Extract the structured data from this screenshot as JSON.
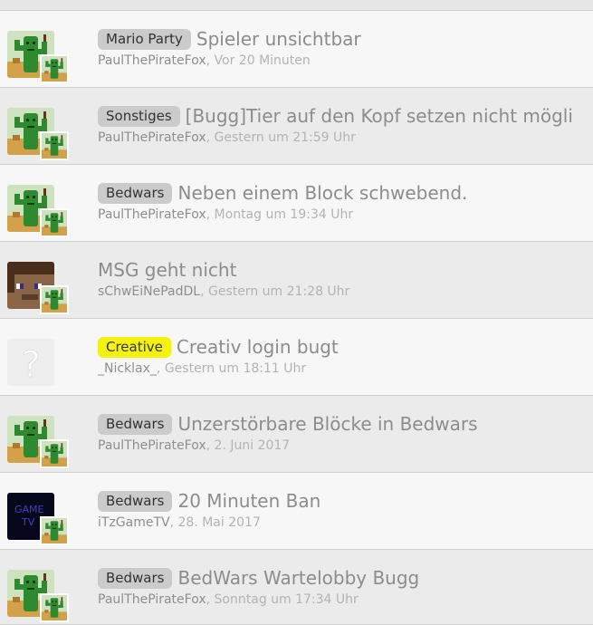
{
  "threads": [
    {
      "prefix": "Mario Party",
      "prefix_style": "gray",
      "title": "Spieler unsichtbar",
      "user": "PaulThePirateFox",
      "time": "Vor 20 Minuten",
      "avatar": "cactus-avatar-icon"
    },
    {
      "prefix": "Sonstiges",
      "prefix_style": "gray",
      "title": "[Bugg]Tier auf den Kopf setzen nicht mögli",
      "user": "PaulThePirateFox",
      "time": "Gestern um 21:59 Uhr",
      "avatar": "cactus-avatar-icon"
    },
    {
      "prefix": "Bedwars",
      "prefix_style": "gray",
      "title": "Neben einem Block schwebend.",
      "user": "PaulThePirateFox",
      "time": "Montag um 19:34 Uhr",
      "avatar": "cactus-avatar-icon"
    },
    {
      "prefix": "",
      "prefix_style": "none",
      "title": "MSG geht nicht",
      "user": "sChwEiNePadDL",
      "time": "Gestern um 21:28 Uhr",
      "avatar": "minecraft-face-avatar-icon"
    },
    {
      "prefix": "Creative",
      "prefix_style": "yellow",
      "title": "Creativ login bugt",
      "user": "_Nicklax_",
      "time": "Gestern um 18:11 Uhr",
      "avatar": "question-mark-avatar-icon"
    },
    {
      "prefix": "Bedwars",
      "prefix_style": "gray",
      "title": "Unzerstörbare Blöcke in Bedwars",
      "user": "PaulThePirateFox",
      "time": "2. Juni 2017",
      "avatar": "cactus-avatar-icon"
    },
    {
      "prefix": "Bedwars",
      "prefix_style": "gray",
      "title": "20 Minuten Ban",
      "user": "iTzGameTV",
      "time": "28. Mai 2017",
      "avatar": "gametv-avatar-icon"
    },
    {
      "prefix": "Bedwars",
      "prefix_style": "gray",
      "title": "BedWars Wartelobby Bugg",
      "user": "PaulThePirateFox",
      "time": "Sonntag um 17:34 Uhr",
      "avatar": "cactus-avatar-icon"
    }
  ],
  "meta_separator": ", ",
  "colors": {
    "prefix_gray": "#cbcbcb",
    "prefix_yellow": "#f5f210",
    "title": "#8c8c8c",
    "meta": "#b3b3b3"
  }
}
